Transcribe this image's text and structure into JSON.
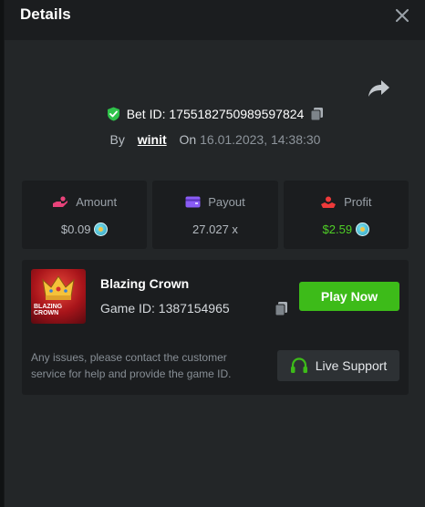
{
  "header": {
    "title": "Details"
  },
  "bet": {
    "id_label": "Bet ID: 1755182750989597824",
    "by_label": "By",
    "user": "winit",
    "on_label": "On",
    "date": "16.01.2023, 14:38:30"
  },
  "stats": {
    "amount": {
      "label": "Amount",
      "value": "$0.09"
    },
    "payout": {
      "label": "Payout",
      "value": "27.027 x"
    },
    "profit": {
      "label": "Profit",
      "value": "$2.59"
    }
  },
  "game": {
    "title": "Blazing Crown",
    "id_label": "Game ID: 1387154965",
    "thumb_text_1": "BLAZING",
    "thumb_text_2": "CROWN",
    "play_label": "Play Now"
  },
  "support": {
    "notice": "Any issues, please contact the customer service for help and provide the game ID.",
    "button_label": "Live Support"
  },
  "colors": {
    "accent_green": "#3dbb19",
    "profit_green": "#4fcf26",
    "shield_green": "#2fc24a",
    "amount_pink": "#e8437a",
    "payout_purple": "#8a5cf5",
    "profit_red": "#ef3a3a"
  },
  "icons": {
    "close": "close-icon",
    "share": "share-icon",
    "shield": "shield-check-icon",
    "copy": "copy-icon",
    "amount": "amount-icon",
    "payout": "wallet-icon",
    "profit": "profit-icon",
    "coin": "coin-icon",
    "headset": "headset-icon"
  }
}
